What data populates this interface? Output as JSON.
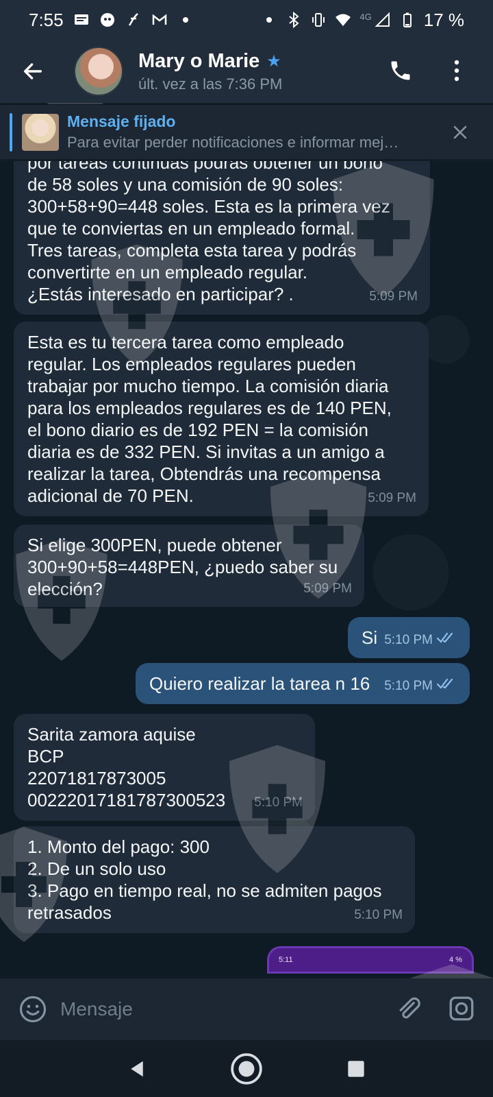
{
  "status_bar": {
    "time": "7:55",
    "network": "4G",
    "battery": "17 %",
    "icons": [
      "message-icon",
      "assistant-icon",
      "app-icon",
      "gmail-icon",
      "dot-icon",
      "dot-icon",
      "bluetooth-icon",
      "vibrate-icon",
      "wifi-icon",
      "signal-icon",
      "battery-icon"
    ]
  },
  "header": {
    "name": "Mary o Marie",
    "last_seen": "últ. vez a las 7:36 PM"
  },
  "pinned": {
    "title": "Mensaje fijado",
    "body": "Para evitar perder notificaciones e informar mej…"
  },
  "messages": [
    {
      "direction": "in",
      "text": "por tareas continuas podrás obtener un bono\nde 58 soles y una comisión de 90 soles:\n300+58+90=448 soles. Esta es la primera vez\nque te conviertas en un empleado formal.\nTres tareas, completa esta tarea y podrás\nconvertirte en un empleado regular.\n¿Estás interesado en participar? .",
      "time": "5:09 PM"
    },
    {
      "direction": "in",
      "text": "Esta es tu tercera tarea como empleado\nregular. Los empleados regulares pueden\ntrabajar por mucho tiempo. La comisión diaria\npara los empleados regulares es de 140 PEN,\nel bono diario es de 192 PEN = la comisión\ndiaria es de 332 PEN. Si invitas a un amigo a\nrealizar la tarea, Obtendrás una recompensa\nadicional de 70 PEN.",
      "time": "5:09 PM"
    },
    {
      "direction": "in",
      "text": "Si elige 300PEN, puede obtener\n300+90+58=448PEN, ¿puedo saber su\nelección?",
      "time": "5:09 PM"
    },
    {
      "direction": "out",
      "text": "Si",
      "time": "5:10 PM"
    },
    {
      "direction": "out",
      "text": "Quiero realizar la tarea n 16",
      "time": "5:10 PM"
    },
    {
      "direction": "in",
      "text": "Sarita zamora aquise\nBCP\n22071817873005\n00222017181787300523",
      "time": "5:10 PM"
    },
    {
      "direction": "in",
      "text": "1. Monto del pago: 300\n2. De un solo uso\n3. Pago en tiempo real, no se admiten pagos\nretrasados",
      "time": "5:10 PM"
    }
  ],
  "thumbnail": {
    "time": "5:11",
    "battery": "4 %"
  },
  "input": {
    "placeholder": "Mensaje"
  },
  "colors": {
    "header_bg": "#212d3b",
    "incoming_bubble": "#1f2b38",
    "outgoing_bubble": "#2b5278",
    "accent": "#4ea4f5"
  }
}
